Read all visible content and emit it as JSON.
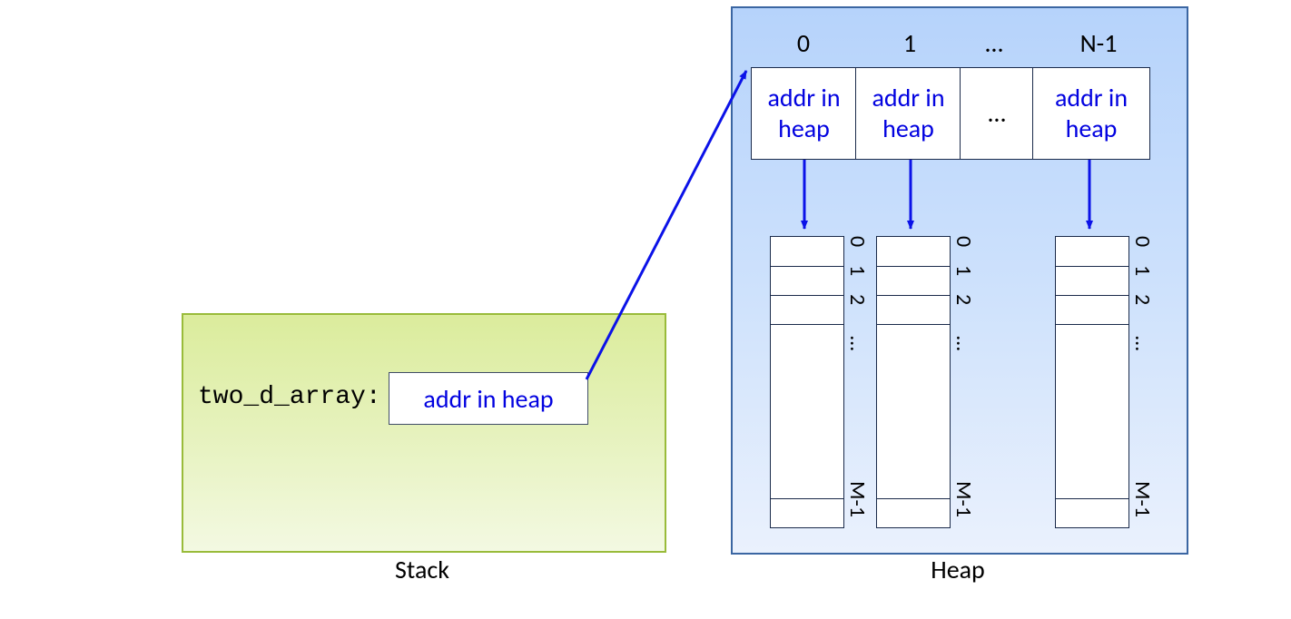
{
  "stack": {
    "label": "Stack",
    "var_name": "two_d_array:",
    "addr_box": "addr in heap"
  },
  "heap": {
    "label": "Heap",
    "top_indices": {
      "c0": "0",
      "c1": "1",
      "c2": "…",
      "c3": "N-1"
    },
    "top_cells": {
      "c0": "addr in\nheap",
      "c1": "addr in\nheap",
      "c2": "…",
      "c3": "addr in\nheap"
    },
    "col_indices": {
      "r0": "0",
      "r1": "1",
      "r2": "2",
      "r3": "…",
      "r4": "M-1"
    }
  }
}
